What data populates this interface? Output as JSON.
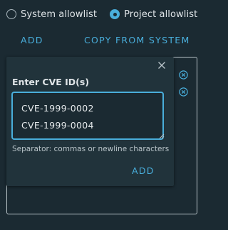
{
  "allowlist_mode": {
    "options": [
      {
        "label": "System allowlist",
        "selected": false
      },
      {
        "label": "Project allowlist",
        "selected": true
      }
    ]
  },
  "actions": {
    "add_label": "ADD",
    "copy_label": "COPY FROM SYSTEM"
  },
  "cve_list": {
    "remove_icon": "close-circle-icon",
    "items_visible_remove_buttons": 2
  },
  "popover": {
    "title": "Enter CVE ID(s)",
    "textarea_value": "CVE-1999-0002\nCVE-1999-0004",
    "hint": "Separator: commas or newline characters",
    "add_label": "ADD",
    "close_icon": "close-icon"
  },
  "colors": {
    "background": "#1b2a32",
    "popover_background": "#21333b",
    "accent": "#49aedb",
    "text": "#dfe4e7",
    "muted_text": "#b9c4c9"
  }
}
